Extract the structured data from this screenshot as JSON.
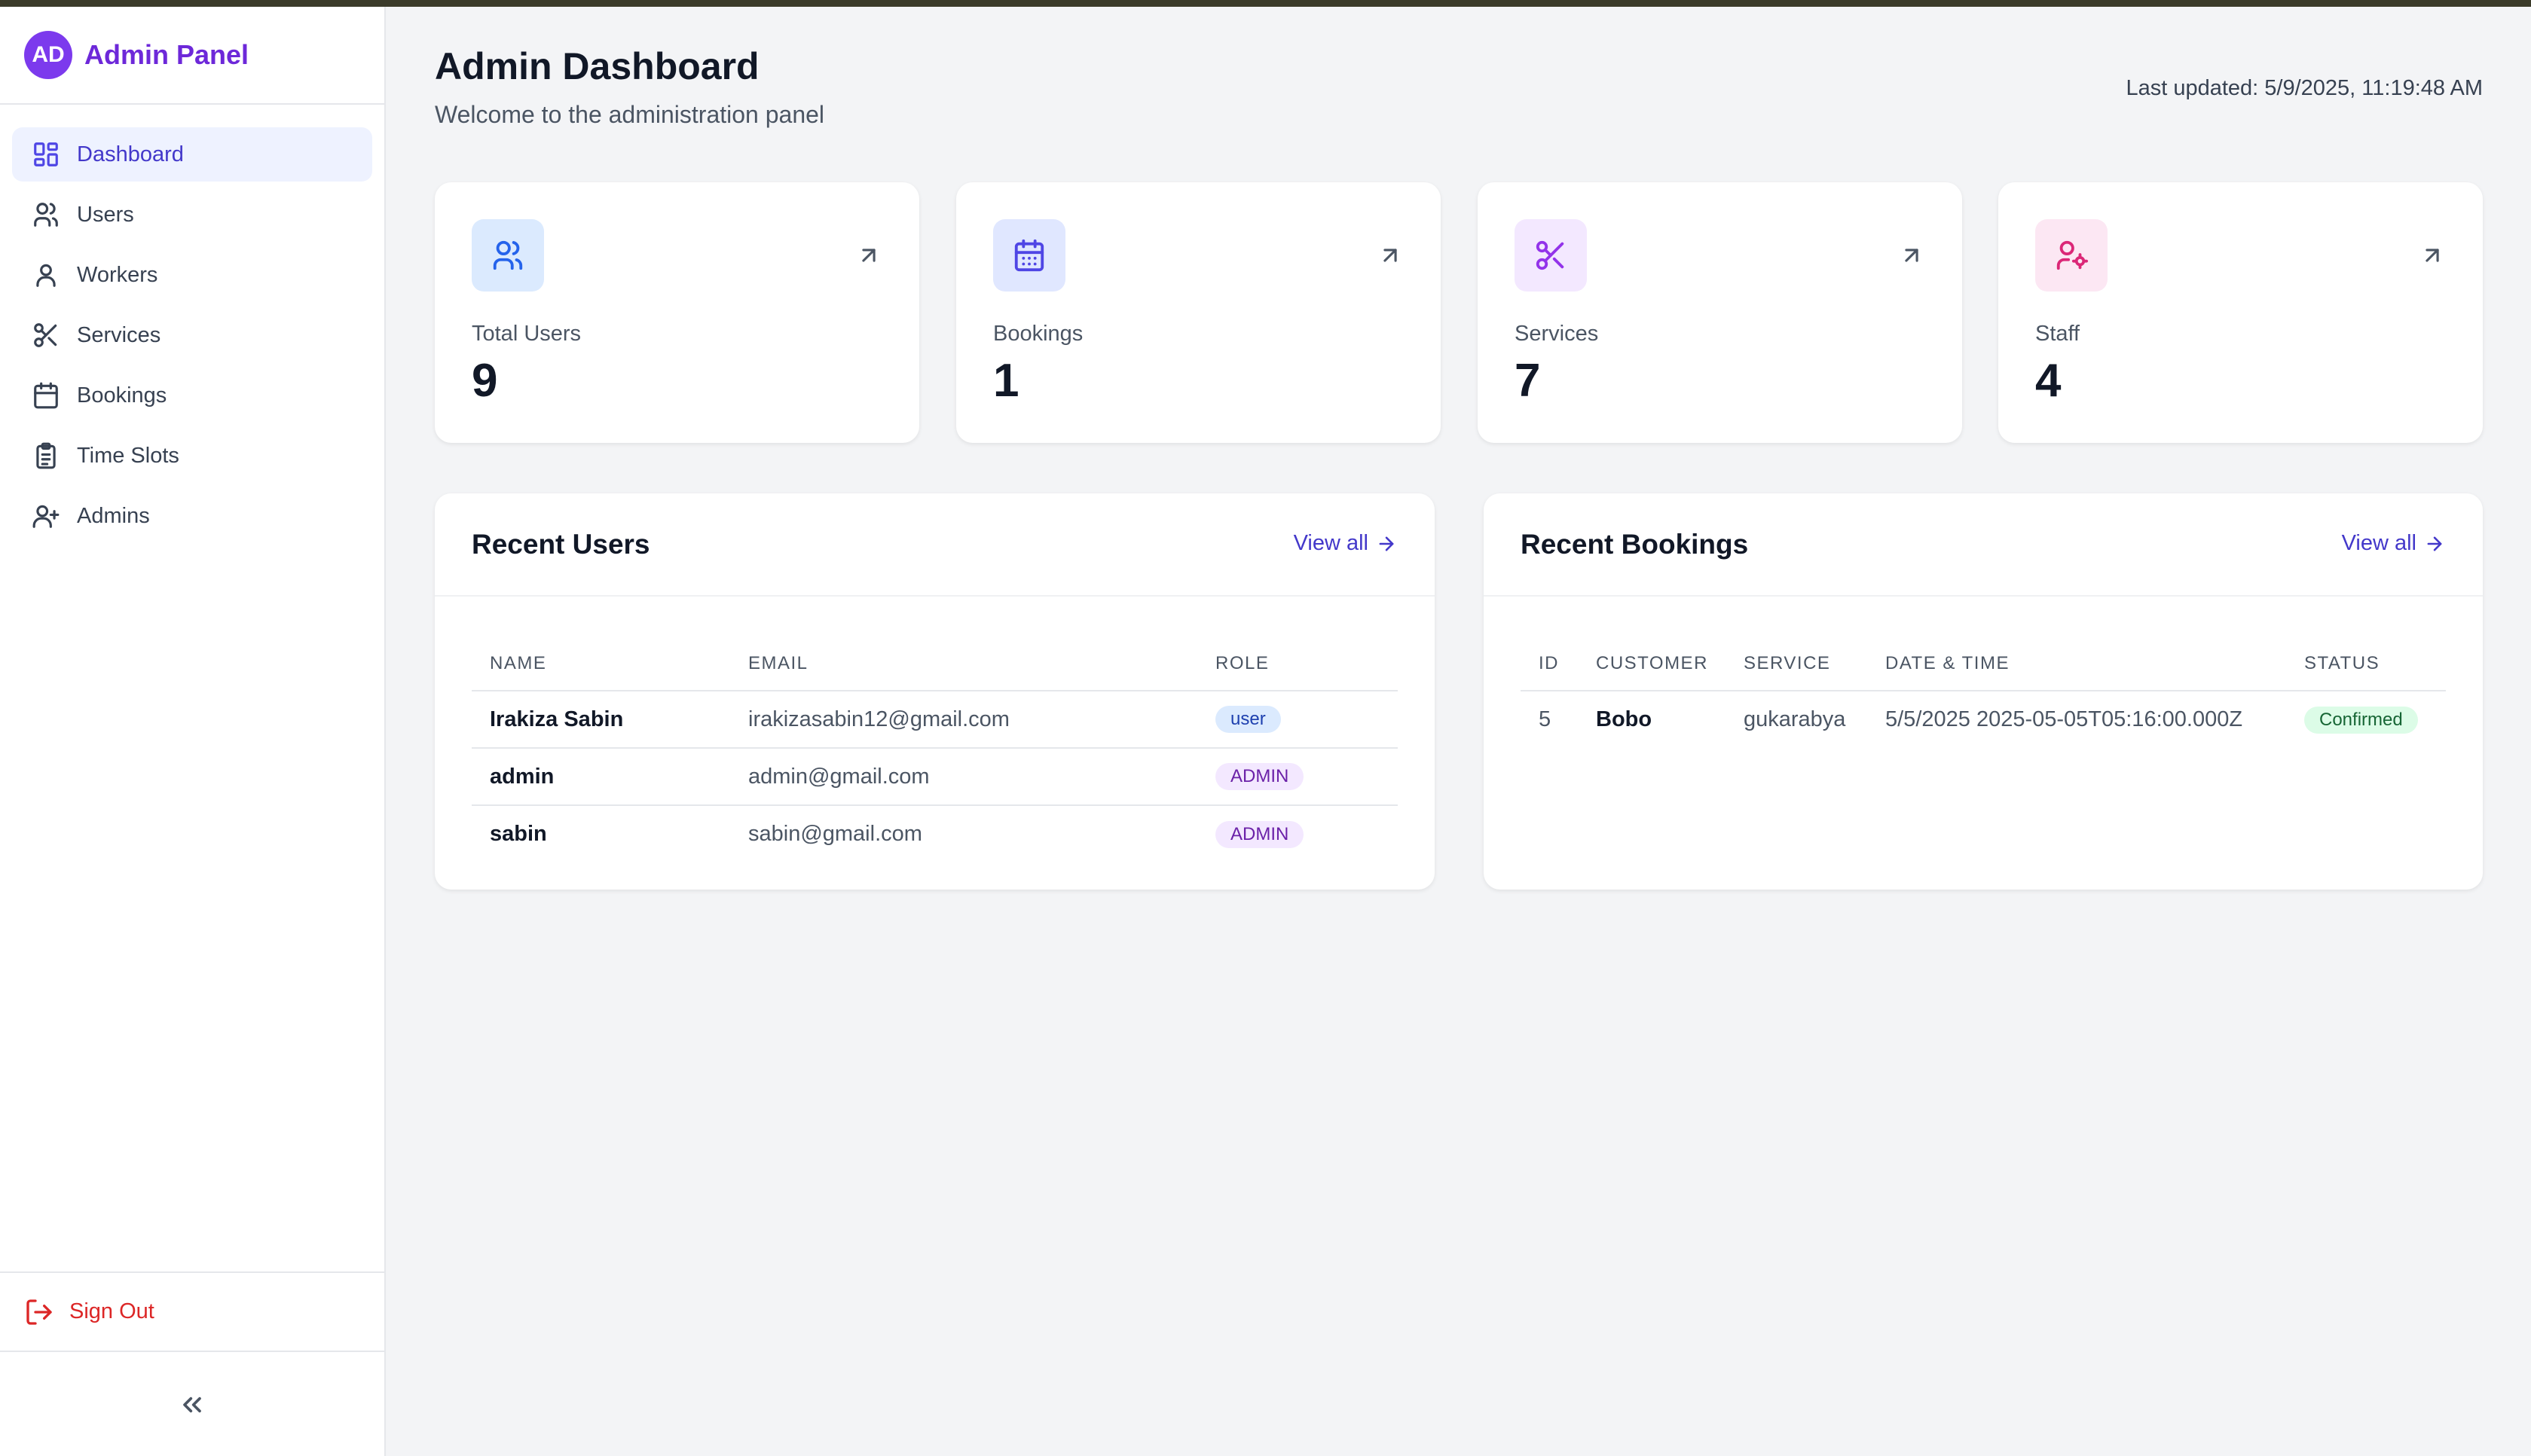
{
  "sidebar": {
    "brand_initials": "AD",
    "brand_title": "Admin Panel",
    "items": [
      {
        "label": "Dashboard"
      },
      {
        "label": "Users"
      },
      {
        "label": "Workers"
      },
      {
        "label": "Services"
      },
      {
        "label": "Bookings"
      },
      {
        "label": "Time Slots"
      },
      {
        "label": "Admins"
      }
    ],
    "signout_label": "Sign Out"
  },
  "header": {
    "title": "Admin Dashboard",
    "subtitle": "Welcome to the administration panel",
    "last_updated": "Last updated: 5/9/2025, 11:19:48 AM"
  },
  "stats": [
    {
      "label": "Total Users",
      "value": "9",
      "icon": "users-icon",
      "color": "#2563eb",
      "bg": "#dbeafe"
    },
    {
      "label": "Bookings",
      "value": "1",
      "icon": "calendar-icon",
      "color": "#4f46e5",
      "bg": "#e0e7ff"
    },
    {
      "label": "Services",
      "value": "7",
      "icon": "scissors-icon",
      "color": "#9333ea",
      "bg": "#f3e8ff"
    },
    {
      "label": "Staff",
      "value": "4",
      "icon": "user-cog-icon",
      "color": "#db2777",
      "bg": "#fce7f3"
    }
  ],
  "recent_users": {
    "title": "Recent Users",
    "view_all": "View all",
    "columns": [
      "NAME",
      "EMAIL",
      "ROLE"
    ],
    "rows": [
      {
        "name": "Irakiza Sabin",
        "email": "irakizasabin12@gmail.com",
        "role": "user"
      },
      {
        "name": "admin",
        "email": "admin@gmail.com",
        "role": "ADMIN"
      },
      {
        "name": "sabin",
        "email": "sabin@gmail.com",
        "role": "ADMIN"
      }
    ]
  },
  "recent_bookings": {
    "title": "Recent Bookings",
    "view_all": "View all",
    "columns": [
      "ID",
      "CUSTOMER",
      "SERVICE",
      "DATE & TIME",
      "STATUS"
    ],
    "rows": [
      {
        "id": "5",
        "customer": "Bobo",
        "service": "gukarabya",
        "datetime": "5/5/2025 2025-05-05T05:16:00.000Z",
        "status": "Confirmed"
      }
    ]
  }
}
